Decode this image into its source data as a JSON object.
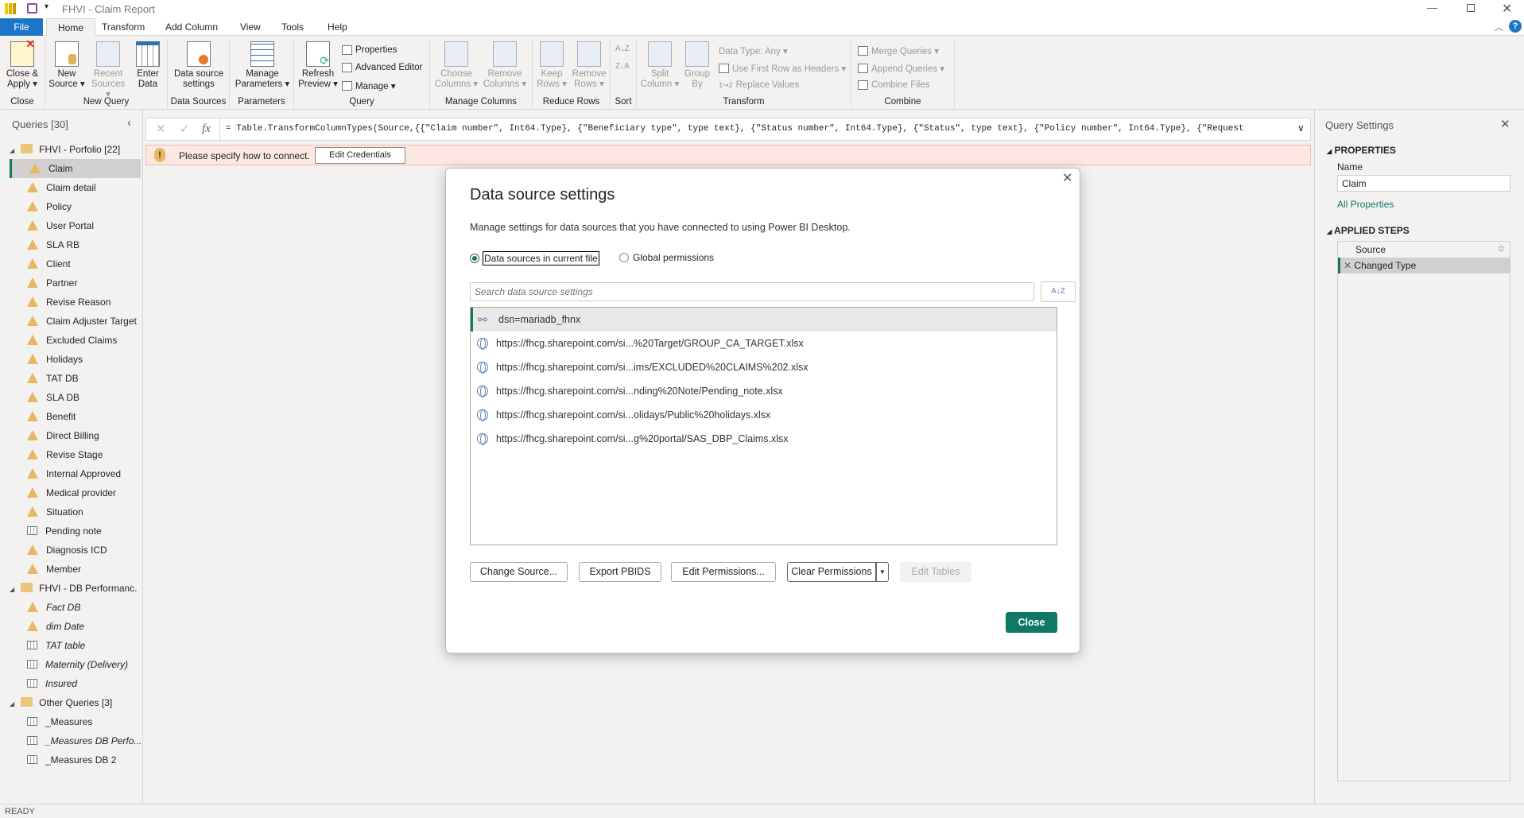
{
  "window": {
    "title": "FHVI - Claim Report"
  },
  "tabs": [
    "File",
    "Home",
    "Transform",
    "Add Column",
    "View",
    "Tools",
    "Help"
  ],
  "ribbon": {
    "groups": [
      "Close",
      "New Query",
      "Data Sources",
      "Parameters",
      "Query",
      "Manage Columns",
      "Reduce Rows",
      "Sort",
      "Transform",
      "Combine"
    ],
    "close_apply": [
      "Close &",
      "Apply ▾"
    ],
    "new_source": [
      "New",
      "Source ▾"
    ],
    "recent_sources": [
      "Recent",
      "Sources ▾"
    ],
    "enter_data": [
      "Enter",
      "Data"
    ],
    "data_source_settings": [
      "Data source",
      "settings"
    ],
    "manage_parameters": [
      "Manage",
      "Parameters ▾"
    ],
    "refresh_preview": [
      "Refresh",
      "Preview ▾"
    ],
    "properties": "Properties",
    "advanced_editor": "Advanced Editor",
    "manage": "Manage ▾",
    "choose_columns": [
      "Choose",
      "Columns ▾"
    ],
    "remove_columns": [
      "Remove",
      "Columns ▾"
    ],
    "keep_rows": [
      "Keep",
      "Rows ▾"
    ],
    "remove_rows": [
      "Remove",
      "Rows ▾"
    ],
    "sort_az": "A↓Z",
    "sort_za": "Z↓A",
    "split_column": [
      "Split",
      "Column ▾"
    ],
    "group_by": [
      "Group",
      "By"
    ],
    "data_type": "Data Type: Any ▾",
    "first_row_headers": "Use First Row as Headers ▾",
    "replace_values": "Replace Values",
    "merge_queries": "Merge Queries ▾",
    "append_queries": "Append Queries ▾",
    "combine_files": "Combine Files"
  },
  "queries": {
    "header": "Queries [30]",
    "groups": [
      {
        "name": "FHVI - Porfolio [22]",
        "items": [
          {
            "label": "Claim",
            "icon": "warning-icon"
          },
          {
            "label": "Claim detail",
            "icon": "warning-icon"
          },
          {
            "label": "Policy",
            "icon": "warning-icon"
          },
          {
            "label": "User Portal",
            "icon": "warning-icon"
          },
          {
            "label": "SLA RB",
            "icon": "warning-icon"
          },
          {
            "label": "Client",
            "icon": "warning-icon"
          },
          {
            "label": "Partner",
            "icon": "warning-icon"
          },
          {
            "label": "Revise Reason",
            "icon": "warning-icon"
          },
          {
            "label": "Claim Adjuster Target",
            "icon": "warning-icon"
          },
          {
            "label": "Excluded Claims",
            "icon": "warning-icon"
          },
          {
            "label": "Holidays",
            "icon": "warning-icon"
          },
          {
            "label": "TAT DB",
            "icon": "warning-icon"
          },
          {
            "label": "SLA DB",
            "icon": "warning-icon"
          },
          {
            "label": "Benefit",
            "icon": "warning-icon"
          },
          {
            "label": "Direct Billing",
            "icon": "warning-icon"
          },
          {
            "label": "Revise Stage",
            "icon": "warning-icon"
          },
          {
            "label": "Internal Approved",
            "icon": "warning-icon"
          },
          {
            "label": "Medical provider",
            "icon": "warning-icon"
          },
          {
            "label": "Situation",
            "icon": "warning-icon"
          },
          {
            "label": "Pending note",
            "icon": "table-icon"
          },
          {
            "label": "Diagnosis ICD",
            "icon": "warning-icon"
          },
          {
            "label": "Member",
            "icon": "warning-icon"
          }
        ]
      },
      {
        "name": "FHVI - DB Performanc...",
        "items": [
          {
            "label": "Fact DB",
            "icon": "warning-icon"
          },
          {
            "label": "dim Date",
            "icon": "warning-icon"
          },
          {
            "label": "TAT table",
            "icon": "table-icon"
          },
          {
            "label": "Maternity (Delivery)",
            "icon": "table-icon"
          },
          {
            "label": "Insured",
            "icon": "table-icon"
          }
        ]
      },
      {
        "name": "Other Queries [3]",
        "items": [
          {
            "label": "_Measures",
            "icon": "table-icon"
          },
          {
            "label": "_Measures DB Perfo...",
            "icon": "table-icon"
          },
          {
            "label": "_Measures DB 2",
            "icon": "table-icon"
          }
        ]
      }
    ],
    "selected": "Claim"
  },
  "formula": {
    "fx": "fx",
    "text": "= Table.TransformColumnTypes(Source,{{\"Claim number\", Int64.Type}, {\"Beneficiary type\", type text}, {\"Status number\", Int64.Type}, {\"Status\", type text}, {\"Policy number\", Int64.Type}, {\"Request"
  },
  "warning": {
    "message": "Please specify how to connect.",
    "button": "Edit Credentials"
  },
  "query_settings": {
    "title": "Query Settings",
    "properties": "PROPERTIES",
    "name_label": "Name",
    "name_value": "Claim",
    "all_properties": "All Properties",
    "applied_steps": "APPLIED STEPS",
    "steps": [
      "Source",
      "Changed Type"
    ]
  },
  "dialog": {
    "title": "Data source settings",
    "description": "Manage settings for data sources that you have connected to using Power BI Desktop.",
    "radio_current": "Data sources in current file",
    "radio_global": "Global permissions",
    "selected_radio": "current",
    "search_placeholder": "Search data source settings",
    "sources": [
      {
        "label": "dsn=mariadb_fhnx",
        "icon": "odbc-icon"
      },
      {
        "label": "https://fhcg.sharepoint.com/si...%20Target/GROUP_CA_TARGET.xlsx",
        "icon": "globe-icon"
      },
      {
        "label": "https://fhcg.sharepoint.com/si...ims/EXCLUDED%20CLAIMS%202.xlsx",
        "icon": "globe-icon"
      },
      {
        "label": "https://fhcg.sharepoint.com/si...nding%20Note/Pending_note.xlsx",
        "icon": "globe-icon"
      },
      {
        "label": "https://fhcg.sharepoint.com/si...olidays/Public%20holidays.xlsx",
        "icon": "globe-icon"
      },
      {
        "label": "https://fhcg.sharepoint.com/si...g%20portal/SAS_DBP_Claims.xlsx",
        "icon": "globe-icon"
      }
    ],
    "buttons": {
      "change_source": "Change Source...",
      "export_pbids": "Export PBIDS",
      "edit_permissions": "Edit Permissions...",
      "clear_permissions": "Clear Permissions",
      "edit_tables": "Edit Tables",
      "close": "Close"
    },
    "accent": "#117865"
  },
  "status": "READY"
}
